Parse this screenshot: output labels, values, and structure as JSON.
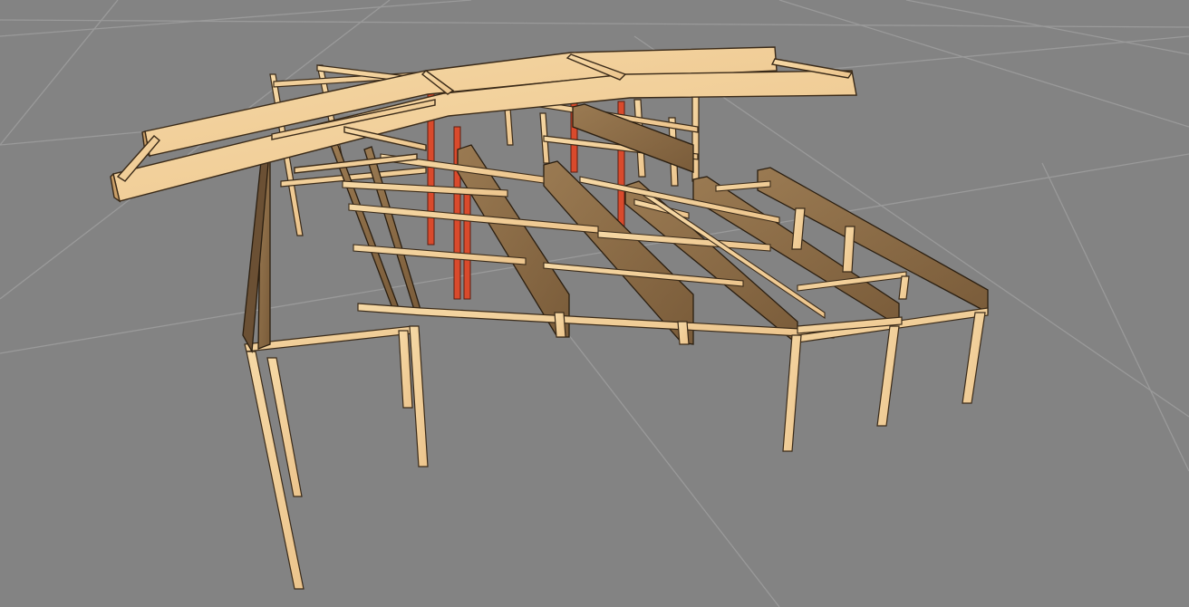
{
  "scene": {
    "subject": "timber-frame-structure",
    "ground_grid": true,
    "colors": {
      "background": "#838383",
      "grid_line": "#9a9a9a",
      "light_timber": "#f2cf99",
      "light_timber_edge": "#3a2a18",
      "dark_timber": "#8a6a45",
      "dark_timber_side": "#6b5034",
      "red_posts": "#d94a2c"
    }
  }
}
